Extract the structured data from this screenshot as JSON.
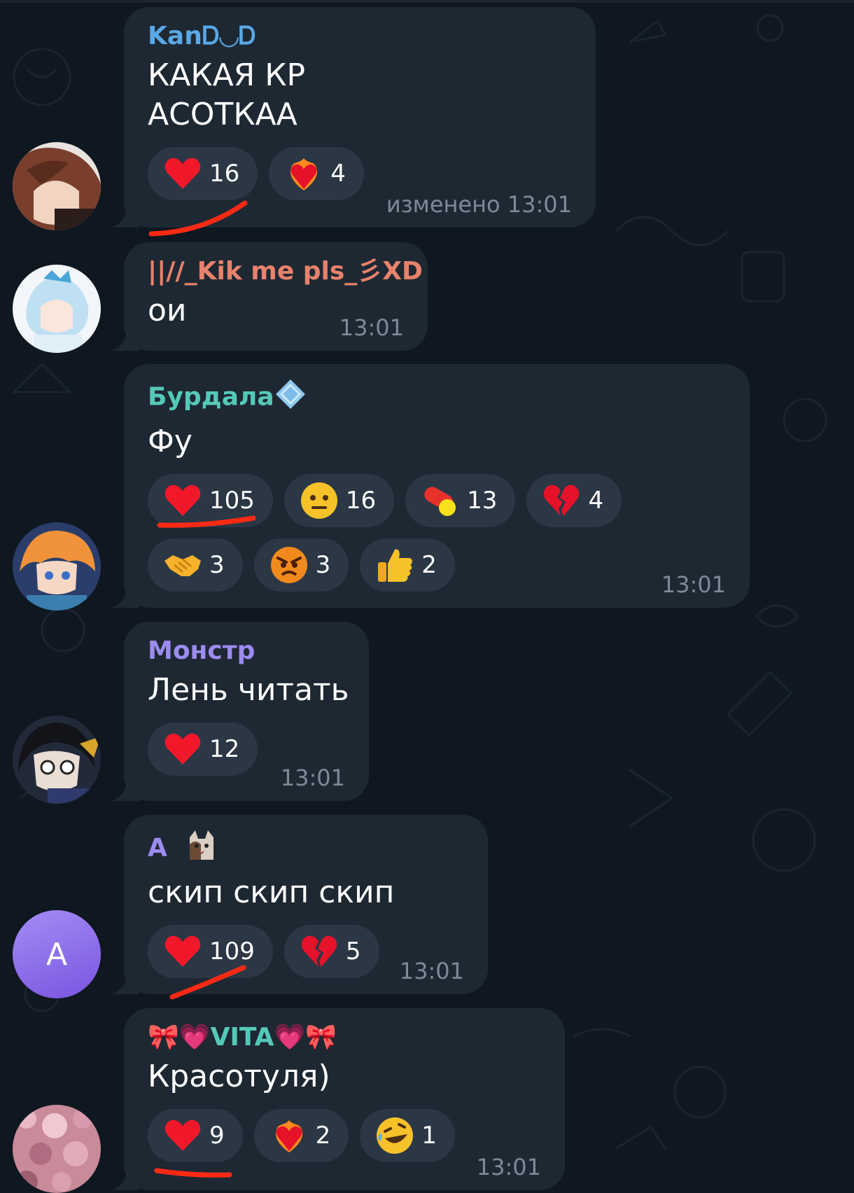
{
  "colors": {
    "background": "#0f1720",
    "bubble": "#1e2833",
    "chip": "#2b3745",
    "time": "#7d8a98",
    "annotation": "#ff2a14"
  },
  "messages": [
    {
      "sender": "KanᎠ◡Ꭰ",
      "sender_color": "#5aa8e6",
      "text_line1": "КАКАЯ КР",
      "text_line2": "АСОТКАА",
      "reactions": [
        {
          "icon": "red-heart-icon",
          "count": "16"
        },
        {
          "icon": "heart-on-fire-icon",
          "count": "4"
        }
      ],
      "time": "изменено 13:01",
      "avatar": "anime-avatar-brown-hair"
    },
    {
      "sender": "||//_Kik me pls_彡XD",
      "sender_color": "#e8826c",
      "text": "ои",
      "time": "13:01",
      "avatar": "anime-avatar-blue-hair"
    },
    {
      "sender": "Бурдала",
      "sender_color": "#55c9b8",
      "badge_icon": "diamond-badge-icon",
      "text": "Фу",
      "reactions": [
        {
          "icon": "red-heart-icon",
          "count": "105"
        },
        {
          "icon": "neutral-face-icon",
          "count": "16"
        },
        {
          "icon": "pill-icon",
          "count": "13"
        },
        {
          "icon": "broken-heart-icon",
          "count": "4"
        },
        {
          "icon": "handshake-icon",
          "count": "3"
        },
        {
          "icon": "angry-face-icon",
          "count": "3"
        },
        {
          "icon": "thumbs-up-icon",
          "count": "2"
        }
      ],
      "time": "13:01",
      "avatar": "anime-avatar-orange-hair"
    },
    {
      "sender": "Монстр",
      "sender_color": "#9b8cf0",
      "text": "Лень читать",
      "reactions": [
        {
          "icon": "red-heart-icon",
          "count": "12"
        }
      ],
      "time": "13:01",
      "avatar": "anime-avatar-dark-hair"
    },
    {
      "sender": "А",
      "sender_color": "#9b8cf0",
      "badge_icon": "cat-sticker-icon",
      "text": "скип скип скип",
      "reactions": [
        {
          "icon": "red-heart-icon",
          "count": "109"
        },
        {
          "icon": "broken-heart-icon",
          "count": "5"
        }
      ],
      "time": "13:01",
      "avatar_letter": "А"
    },
    {
      "sender_prefix": "🎀💗",
      "sender": "VITA",
      "sender_suffix": "💗🎀",
      "sender_color": "#55c9b8",
      "text": "Красотуля)",
      "reactions": [
        {
          "icon": "red-heart-icon",
          "count": "9"
        },
        {
          "icon": "heart-on-fire-icon",
          "count": "2"
        },
        {
          "icon": "rofl-face-icon",
          "count": "1"
        }
      ],
      "time": "13:01",
      "avatar": "pink-blossom-avatar"
    }
  ]
}
